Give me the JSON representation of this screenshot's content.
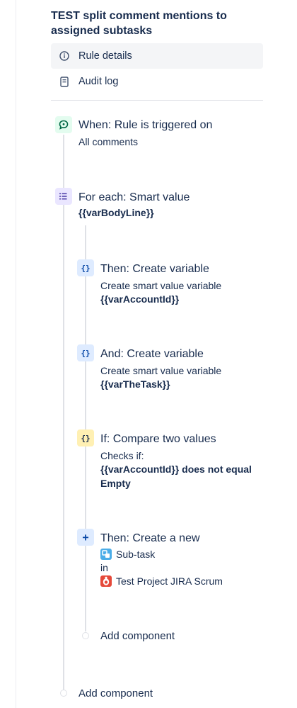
{
  "rule": {
    "title": "TEST split comment mentions to assigned subtasks"
  },
  "nav": {
    "items": [
      {
        "label": "Rule details",
        "icon": "info-icon",
        "selected": true
      },
      {
        "label": "Audit log",
        "icon": "audit-log-icon",
        "selected": false
      }
    ]
  },
  "components": {
    "trigger": {
      "title": "When: Rule is triggered on",
      "detail": "All comments",
      "icon": "comment-trigger-icon"
    },
    "branch": {
      "title": "For each: Smart value",
      "detail": "{{varBodyLine}}",
      "icon": "branch-list-icon"
    },
    "create_var_1": {
      "icon_glyph": "{}",
      "title": "Then: Create variable",
      "line1": "Create smart value variable",
      "line2": "{{varAccountId}}"
    },
    "create_var_2": {
      "icon_glyph": "{}",
      "title": "And: Create variable",
      "line1": "Create smart value variable",
      "line2": "{{varTheTask}}"
    },
    "condition": {
      "icon_glyph": "{}",
      "title": "If: Compare two values",
      "line1": "Checks if:",
      "line2": "{{varAccountId}} does not equal",
      "line3": "Empty"
    },
    "create_issue": {
      "icon_glyph": "+",
      "title": "Then: Create a new",
      "issue_type": "Sub-task",
      "in_label": "in",
      "project": "Test Project JIRA Scrum"
    }
  },
  "add_component": {
    "inner_label": "Add component",
    "outer_label": "Add component"
  },
  "colors": {
    "trigger_bg": "#e3fcef",
    "branch_bg": "#eae6ff",
    "action_bg": "#deebff",
    "condition_bg": "#fff0b3",
    "text": "#172b4d",
    "line": "#dfe1e6",
    "subtask_blue": "#4bade8",
    "project_red": "#e5493a"
  }
}
